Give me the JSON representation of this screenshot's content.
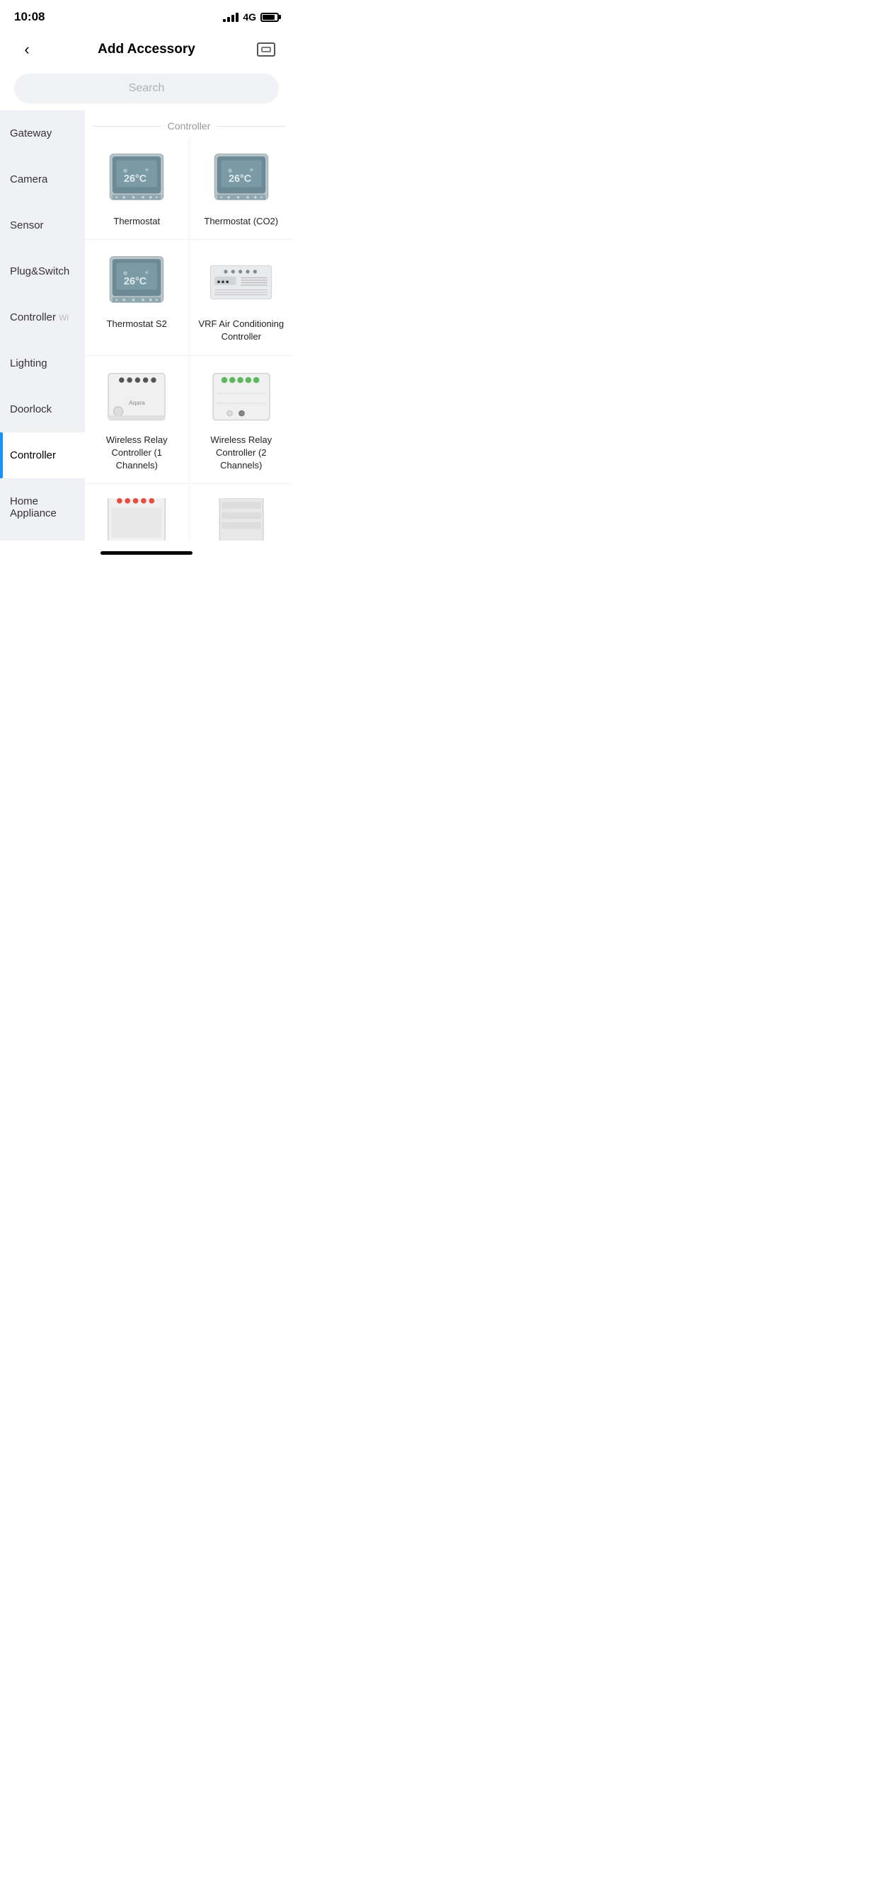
{
  "statusBar": {
    "time": "10:08",
    "signal": "4G",
    "batteryLevel": 85
  },
  "header": {
    "title": "Add Accessory",
    "backLabel": "back",
    "scanLabel": "scan"
  },
  "search": {
    "placeholder": "Search"
  },
  "sidebar": {
    "items": [
      {
        "id": "gateway",
        "label": "Gateway",
        "active": false
      },
      {
        "id": "camera",
        "label": "Camera",
        "active": false
      },
      {
        "id": "sensor",
        "label": "Sensor",
        "active": false
      },
      {
        "id": "plug-switch",
        "label": "Plug&Switch",
        "active": false
      },
      {
        "id": "controller-wi",
        "label": "Controller",
        "suffix": "Wi",
        "active": false
      },
      {
        "id": "lighting",
        "label": "Lighting",
        "active": false
      },
      {
        "id": "doorlock",
        "label": "Doorlock",
        "active": false
      },
      {
        "id": "controller",
        "label": "Controller",
        "active": true
      },
      {
        "id": "home-appliance",
        "label": "Home Appliance",
        "active": false
      }
    ]
  },
  "sections": [
    {
      "id": "controller-section",
      "label": "Controller",
      "products": [
        {
          "id": "thermostat",
          "name": "Thermostat",
          "type": "thermostat"
        },
        {
          "id": "thermostat-co2",
          "name": "Thermostat (CO2)",
          "type": "thermostat"
        },
        {
          "id": "thermostat-s2",
          "name": "Thermostat S2",
          "type": "thermostat"
        },
        {
          "id": "vrf-ac",
          "name": "VRF Air Conditioning Controller",
          "type": "vrf"
        },
        {
          "id": "relay-1ch",
          "name": "Wireless Relay Controller (1 Channels)",
          "type": "relay1"
        },
        {
          "id": "relay-2ch",
          "name": "Wireless Relay Controller (2 Channels)",
          "type": "relay2"
        },
        {
          "id": "partial1",
          "name": "",
          "type": "partial1"
        },
        {
          "id": "partial2",
          "name": "",
          "type": "partial2"
        }
      ]
    }
  ]
}
